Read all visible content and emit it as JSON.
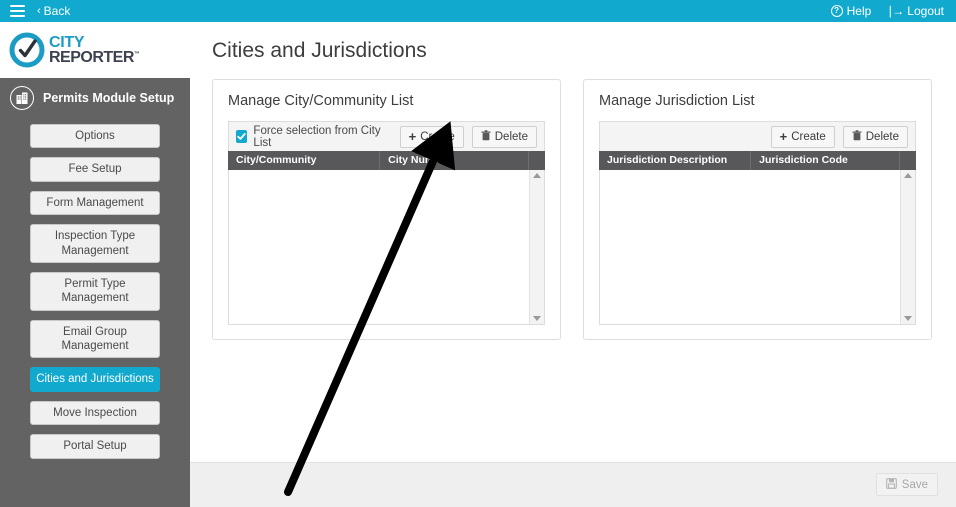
{
  "topbar": {
    "menu_icon": "hamburger-icon",
    "back_label": "Back",
    "back_chevron": "‹",
    "help_label": "Help",
    "help_icon": "question-circle-icon",
    "logout_label": "Logout",
    "logout_icon": "logout-arrow-icon",
    "background_color": "#12a9ce"
  },
  "sidebar": {
    "logo": {
      "primary": "CITY",
      "secondary": "REPORTER",
      "trademark": "™",
      "icon": "city-reporter-check-logo"
    },
    "module": {
      "label": "Permits Module Setup",
      "icon": "building-circle-icon"
    },
    "background_color": "#636363",
    "active_color": "#12a9ce",
    "items": [
      {
        "label": "Options",
        "active": false
      },
      {
        "label": "Fee Setup",
        "active": false
      },
      {
        "label": "Form Management",
        "active": false
      },
      {
        "label": "Inspection Type Management",
        "active": false
      },
      {
        "label": "Permit Type Management",
        "active": false
      },
      {
        "label": "Email Group Management",
        "active": false
      },
      {
        "label": "Cities and Jurisdictions",
        "active": true
      },
      {
        "label": "Move Inspection",
        "active": false
      },
      {
        "label": "Portal Setup",
        "active": false
      }
    ]
  },
  "main": {
    "page_title": "Cities and Jurisdictions",
    "panels": [
      {
        "title": "Manage City/Community List",
        "checkbox": {
          "label": "Force selection from City List",
          "checked": true
        },
        "create_label": "Create",
        "create_icon": "plus-icon",
        "delete_label": "Delete",
        "delete_icon": "trash-icon",
        "columns": [
          "City/Community",
          "City Number"
        ],
        "rows": []
      },
      {
        "title": "Manage Jurisdiction List",
        "checkbox": null,
        "create_label": "Create",
        "create_icon": "plus-icon",
        "delete_label": "Delete",
        "delete_icon": "trash-icon",
        "columns": [
          "Jurisdiction Description",
          "Jurisdiction Code"
        ],
        "rows": []
      }
    ]
  },
  "footer": {
    "save_label": "Save",
    "save_icon": "floppy-disk-icon",
    "save_disabled": true
  },
  "annotation": {
    "type": "arrow",
    "points_to": "create-button-city-panel",
    "color": "#000000"
  }
}
